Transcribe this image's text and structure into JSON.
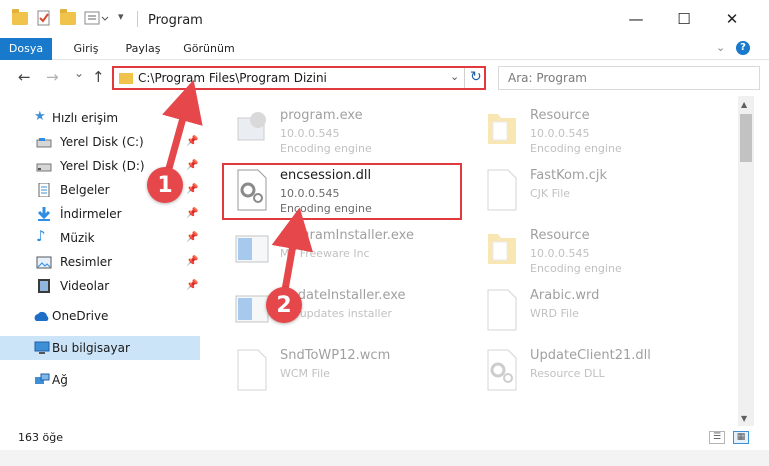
{
  "window": {
    "title": "Program",
    "controls": {
      "minimize": "—",
      "maximize": "☐",
      "close": "✕"
    }
  },
  "ribbon": {
    "tabs": [
      {
        "label": "Dosya",
        "active": true
      },
      {
        "label": "Giriş"
      },
      {
        "label": "Paylaş"
      },
      {
        "label": "Görünüm"
      }
    ],
    "expand_icon": "chevron-down-icon",
    "help_icon": "?"
  },
  "navigation": {
    "back": "←",
    "forward": "→",
    "recent": "⌄",
    "up": "↑",
    "address": "C:\\Program Files\\Program Dizini",
    "refresh": "↻",
    "search_placeholder": "Ara: Program"
  },
  "sidebar": {
    "quick_access": "Hızlı erişim",
    "items": [
      {
        "label": "Yerel Disk (C:)",
        "icon": "drive-icon",
        "pinned": true
      },
      {
        "label": "Yerel Disk (D:)",
        "icon": "drive-icon",
        "pinned": true
      },
      {
        "label": "Belgeler",
        "icon": "documents-icon",
        "pinned": true
      },
      {
        "label": "İndirmeler",
        "icon": "download-icon",
        "pinned": true
      },
      {
        "label": "Müzik",
        "icon": "music-icon",
        "pinned": true
      },
      {
        "label": "Resimler",
        "icon": "pictures-icon",
        "pinned": true
      },
      {
        "label": "Videolar",
        "icon": "video-icon",
        "pinned": true
      }
    ],
    "onedrive": "OneDrive",
    "this_pc": "Bu bilgisayar",
    "network": "Ağ"
  },
  "files": [
    {
      "name": "program.exe",
      "line1": "10.0.0.545",
      "line2": "Encoding engine",
      "icon": "app-icon"
    },
    {
      "name": "Resource",
      "line1": "10.0.0.545",
      "line2": "Encoding engine",
      "icon": "folder-icon"
    },
    {
      "name": "encsession.dll",
      "line1": "10.0.0.545",
      "line2": "Encoding engine",
      "icon": "dll-gear-icon",
      "highlighted": true
    },
    {
      "name": "FastKom.cjk",
      "line1": "CJK File",
      "line2": "",
      "icon": "blank-file-icon"
    },
    {
      "name": "programInstaller.exe",
      "line1": "MY Freeware Inc",
      "line2": "",
      "icon": "installer-icon"
    },
    {
      "name": "Resource",
      "line1": "10.0.0.545",
      "line2": "Encoding engine",
      "icon": "folder-icon"
    },
    {
      "name": "UpdateInstaller.exe",
      "line1": "MY updates installer",
      "line2": "",
      "icon": "installer-icon"
    },
    {
      "name": "Arabic.wrd",
      "line1": "WRD File",
      "line2": "",
      "icon": "blank-file-icon"
    },
    {
      "name": "SndToWP12.wcm",
      "line1": "WCM File",
      "line2": "",
      "icon": "blank-file-icon"
    },
    {
      "name": "UpdateClient21.dll",
      "line1": "Resource DLL",
      "line2": "",
      "icon": "dll-gear-icon"
    }
  ],
  "status": {
    "count": "163 öğe"
  },
  "annotations": {
    "step1": "1",
    "step2": "2",
    "color": "#e5474b"
  }
}
